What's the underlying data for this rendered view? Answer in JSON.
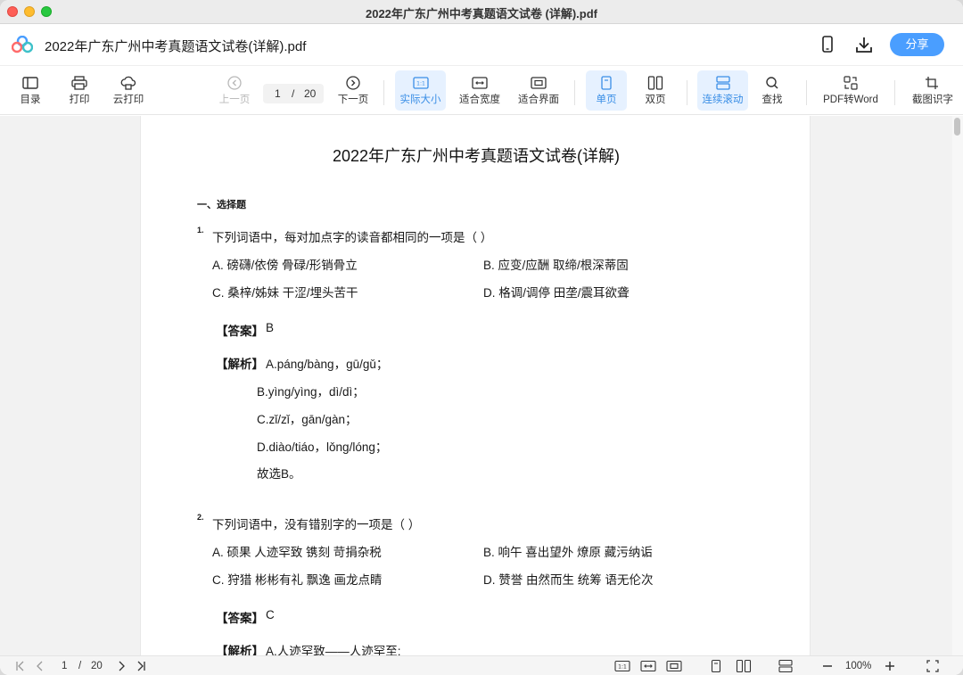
{
  "window": {
    "title": "2022年广东广州中考真题语文试卷 (详解).pdf"
  },
  "header": {
    "doc_name": "2022年广东广州中考真题语文试卷(详解).pdf",
    "share_label": "分享"
  },
  "toolbar": {
    "toc": "目录",
    "print": "打印",
    "cloud_print": "云打印",
    "prev_page": "上一页",
    "current_page": "1",
    "page_sep": "/",
    "total_pages": "20",
    "next_page": "下一页",
    "actual_size": "实际大小",
    "fit_width": "适合宽度",
    "fit_screen": "适合界面",
    "single_page": "单页",
    "double_page": "双页",
    "continuous_scroll": "连续滚动",
    "find": "查找",
    "pdf_to_word": "PDF转Word",
    "ocr": "截图识字"
  },
  "document": {
    "title": "2022年广东广州中考真题语文试卷(详解)",
    "section": "一、选择题",
    "q1": {
      "num": "1.",
      "stem": "下列词语中，每对加点字的读音都相同的一项是（   ）",
      "a": "A. 磅礴/依傍    骨碌/形销骨立",
      "b": "B. 应变/应酬    取缔/根深蒂固",
      "c": "C. 桑梓/姊妹    干涩/埋头苦干",
      "d": "D. 格调/调停    田垄/震耳欲聋",
      "answer_tag": "【答案】",
      "answer": "B",
      "analysis_tag": "【解析】",
      "analysis": [
        "A.páng/bàng，gū/gǔ；",
        "B.yìng/yìng，dì/dì；",
        "C.zǐ/zǐ，gān/gàn；",
        "D.diào/tiáo，lǒng/lóng；",
        "故选B。"
      ]
    },
    "q2": {
      "num": "2.",
      "stem": "下列词语中，没有错别字的一项是（   ）",
      "a": "A. 硕果    人迹罕致    镌刻    苛捐杂税",
      "b": "B. 响午    喜出望外    燎原    藏污纳诟",
      "c": "C. 狩猎    彬彬有礼    飘逸    画龙点睛",
      "d": "D. 赞誉    由然而生    统筹    语无伦次",
      "answer_tag": "【答案】",
      "answer": "C",
      "analysis_tag": "【解析】",
      "analysis_first": "A.人迹罕致——人迹罕至;"
    }
  },
  "bottombar": {
    "current_page": "1",
    "page_sep": "/",
    "total_pages": "20",
    "zoom": "100%"
  },
  "colors": {
    "accent": "#4a9eff",
    "active_bg": "#e6f1ff",
    "active_text": "#3a8ee6"
  }
}
